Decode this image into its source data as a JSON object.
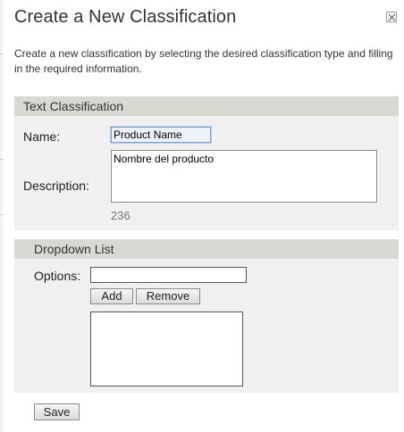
{
  "dialog": {
    "title": "Create a New Classification",
    "intro": "Create a new classification by selecting the desired classification type and filling in the required information.",
    "close_icon": "close-x-icon"
  },
  "text_classification": {
    "header": "Text Classification",
    "name_label": "Name:",
    "name_value": "Product Name",
    "description_label": "Description:",
    "description_value": "Nombre del producto",
    "char_counter": "236"
  },
  "dropdown_list": {
    "header": "Dropdown List",
    "options_label": "Options:",
    "options_value": "",
    "add_label": "Add",
    "remove_label": "Remove",
    "options_items": []
  },
  "footer": {
    "save_label": "Save"
  },
  "colors": {
    "section_header_bg": "#d9d9d3",
    "section_bg": "#f0f0f0",
    "name_input_border": "#7a9ccf"
  }
}
